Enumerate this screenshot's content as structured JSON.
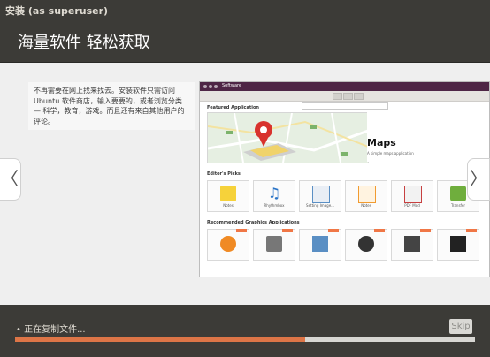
{
  "window": {
    "title": "安装 (as superuser)"
  },
  "header": {
    "title": "海量软件 轻松获取"
  },
  "slide": {
    "text": "不再需要在网上找来找去。安装软件只需访问 Ubuntu 软件商店，输入要要的，或者浏览分类 — 科学，教育，游戏。而且还有来自其他用户的评论。",
    "prev_label": "〈",
    "next_label": "〉",
    "screenshot": {
      "title": "Software",
      "featured_label": "Featured Application",
      "banner_title": "Maps",
      "banner_subtitle": "A simple maps application",
      "editors_picks_label": "Editor's Picks",
      "recommended_label": "Recommended Graphics Applications",
      "picks": [
        {
          "label": "Notes",
          "icon": "notes-icon",
          "color": "#f6d23a"
        },
        {
          "label": "Rhythmbox",
          "icon": "music-icon",
          "color": "#2a74c7"
        },
        {
          "label": "Setting Image...",
          "icon": "settings-icon",
          "color": "#5a8fc4"
        },
        {
          "label": "Notes",
          "icon": "box-icon",
          "color": "#f19b30"
        },
        {
          "label": "PDF Mod",
          "icon": "pdf-icon",
          "color": "#c74040"
        },
        {
          "label": "Transfer",
          "icon": "transfer-icon",
          "color": "#6fae3d"
        }
      ]
    }
  },
  "footer": {
    "status": "• 正在复制文件...",
    "skip_label": "Skip",
    "progress": 0.63
  },
  "colors": {
    "accent": "#dd7547",
    "window_bg": "#3c3b37",
    "slide_bg": "#efefef"
  }
}
